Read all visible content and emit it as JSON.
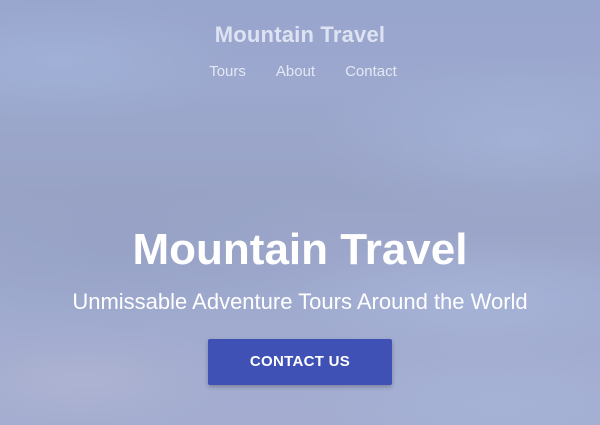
{
  "header": {
    "site_title": "Mountain Travel",
    "nav": [
      {
        "label": "Tours"
      },
      {
        "label": "About"
      },
      {
        "label": "Contact"
      }
    ]
  },
  "hero": {
    "title": "Mountain Travel",
    "subtitle": "Unmissable Adventure Tours Around the World",
    "cta_label": "CONTACT US"
  },
  "colors": {
    "accent": "#3f51b5",
    "text": "#ffffff"
  }
}
